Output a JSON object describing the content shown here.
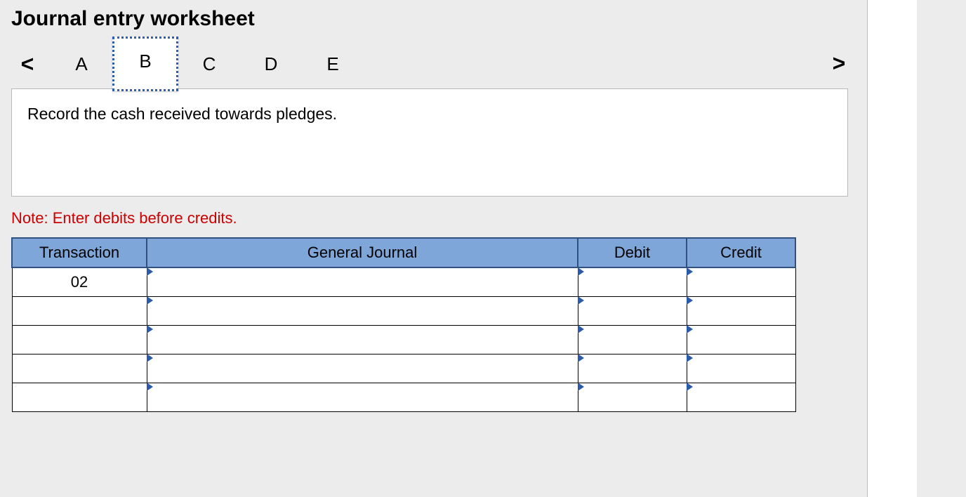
{
  "title": "Journal entry worksheet",
  "nav": {
    "prev_label": "<",
    "next_label": ">",
    "tabs": [
      "A",
      "B",
      "C",
      "D",
      "E"
    ],
    "active_index": 1
  },
  "instruction": "Record the cash received towards pledges.",
  "note": "Note: Enter debits before credits.",
  "table": {
    "headers": {
      "transaction": "Transaction",
      "general_journal": "General Journal",
      "debit": "Debit",
      "credit": "Credit"
    },
    "rows": [
      {
        "transaction": "02",
        "gj": "",
        "debit": "",
        "credit": ""
      },
      {
        "transaction": "",
        "gj": "",
        "debit": "",
        "credit": ""
      },
      {
        "transaction": "",
        "gj": "",
        "debit": "",
        "credit": ""
      },
      {
        "transaction": "",
        "gj": "",
        "debit": "",
        "credit": ""
      },
      {
        "transaction": "",
        "gj": "",
        "debit": "",
        "credit": ""
      }
    ]
  }
}
